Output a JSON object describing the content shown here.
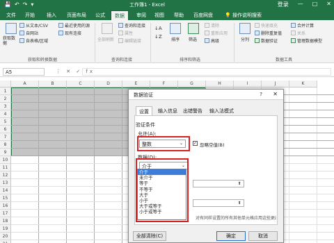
{
  "window": {
    "title": "工作簿1 - Excel",
    "login": "登录",
    "controls": [
      "—",
      "□",
      "✕"
    ],
    "qat": [
      "💾",
      "↶",
      "↷",
      "▾"
    ]
  },
  "tabs": [
    "文件",
    "开始",
    "插入",
    "页面布局",
    "公式",
    "数据",
    "审阅",
    "视图",
    "帮助",
    "百度网盘"
  ],
  "tell_me": "操作说明搜索",
  "ribbon": {
    "get_data": "获取数\n据",
    "from_text_csv": "从文本/CSV",
    "from_web": "自网站",
    "from_table": "自表格/区域",
    "recent_sources": "最近使用的源",
    "existing_conn": "现有连接",
    "group_get": "获取和转换数据",
    "refresh_all": "全部刷新",
    "queries_conn": "查询和连接",
    "properties": "属性",
    "edit_links": "编辑链接",
    "group_query": "查询和连接",
    "sort": "排序",
    "filter": "筛选",
    "clear": "清除",
    "reapply": "重新应用",
    "advanced": "高级",
    "group_sort": "排序和筛选",
    "text_to_cols": "分列",
    "flash_fill": "快速填充",
    "remove_dup": "删除重复值",
    "data_validation": "数据验证",
    "consolidate": "合并计算",
    "relationships": "关系",
    "manage_model": "管理数据模型",
    "group_tools": "数据工具"
  },
  "formula_bar": {
    "name_box": "A5",
    "icons": "⋮ ✕ ✓ fx"
  },
  "columns": [
    "A",
    "B",
    "C",
    "D",
    "E",
    "F",
    "G",
    "H",
    "I",
    "J",
    "K"
  ],
  "rows": [
    "1",
    "2",
    "3",
    "4",
    "5",
    "6",
    "7",
    "8",
    "9",
    "10",
    "11",
    "12",
    "13",
    "14",
    "15",
    "16",
    "17",
    "18",
    "19",
    "20",
    "21"
  ],
  "dialog": {
    "title": "数据验证",
    "help": "?",
    "close": "✕",
    "tabs": [
      "设置",
      "输入信息",
      "出错警告",
      "输入法模式"
    ],
    "criteria_label": "验证条件",
    "allow_label": "允许(A):",
    "allow_value": "整数",
    "ignore_blank": "忽略空值(B)",
    "data_label": "数据(D):",
    "data_value": "介于",
    "data_options": [
      "介于",
      "未介于",
      "等于",
      "不等于",
      "大于",
      "小于",
      "大于或等于",
      "小于或等于"
    ],
    "apply_all": "对有同样设置的所有其他单元格应用这些更改(P)",
    "clear_all": "全部清除(C)",
    "ok": "确定",
    "cancel": "取消"
  },
  "colors": {
    "excel_green": "#217346",
    "highlight_red": "#d32020",
    "selection_gray": "#c4c4c4"
  }
}
